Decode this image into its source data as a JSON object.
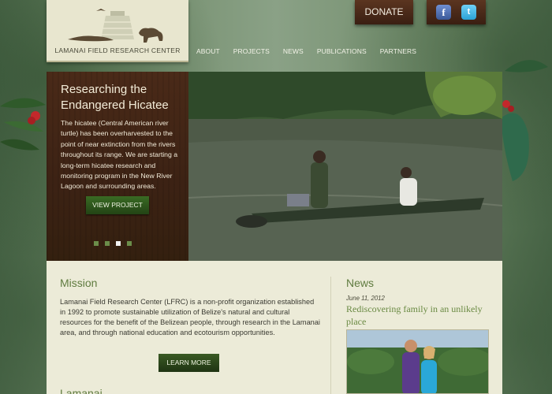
{
  "logo": {
    "text": "LAMANAI FIELD RESEARCH CENTER"
  },
  "nav": {
    "items": [
      "ABOUT",
      "PROJECTS",
      "NEWS",
      "PUBLICATIONS",
      "PARTNERS"
    ]
  },
  "header": {
    "donate_label": "DONATE",
    "social": [
      "facebook-icon",
      "twitter-icon"
    ]
  },
  "hero": {
    "title_line1": "Researching the",
    "title_line2": "Endangered Hicatee",
    "text": "The hicatee (Central American river turtle) has been overharvested to the point of near extinction from the rivers throughout its range. We are starting a long-term hicatee research and monitoring program in the New River Lagoon and surrounding areas.",
    "button_label": "VIEW PROJECT",
    "slide_count": 4,
    "active_slide": 3
  },
  "mission": {
    "title": "Mission",
    "text": "Lamanai Field Research Center (LFRC) is a non-profit organization established in 1992 to promote sustainable utilization of Belize's natural and cultural resources for the benefit of the Belizean people, through research in the Lamanai area, and through national education and ecotourism opportunities.",
    "button_label": "LEARN MORE",
    "next_heading": "Lamanai"
  },
  "news": {
    "title": "News",
    "date": "June 11, 2012",
    "headline": "Rediscovering family in an unlikely place"
  },
  "colors": {
    "accent_green": "#5f7b3f",
    "wood_brown": "#3c2214",
    "panel_cream": "#ecebd8"
  }
}
